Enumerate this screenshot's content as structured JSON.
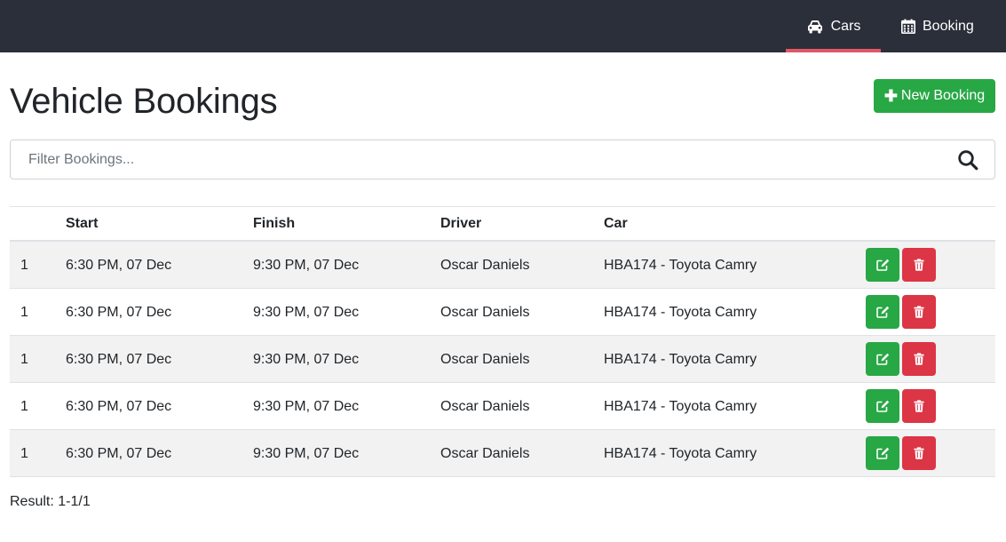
{
  "nav": {
    "items": [
      {
        "label": "Cars",
        "icon": "car-icon",
        "active": true
      },
      {
        "label": "Booking",
        "icon": "calendar-icon",
        "active": false
      }
    ]
  },
  "page": {
    "title": "Vehicle Bookings"
  },
  "actions": {
    "new_booking_label": "New Booking"
  },
  "search": {
    "placeholder": "Filter Bookings..."
  },
  "table": {
    "headers": [
      "",
      "Start",
      "Finish",
      "Driver",
      "Car",
      ""
    ],
    "rows": [
      {
        "id": "1",
        "start": "6:30 PM, 07 Dec",
        "finish": "9:30 PM, 07 Dec",
        "driver": "Oscar Daniels",
        "car": "HBA174 - Toyota Camry"
      },
      {
        "id": "1",
        "start": "6:30 PM, 07 Dec",
        "finish": "9:30 PM, 07 Dec",
        "driver": "Oscar Daniels",
        "car": "HBA174 - Toyota Camry"
      },
      {
        "id": "1",
        "start": "6:30 PM, 07 Dec",
        "finish": "9:30 PM, 07 Dec",
        "driver": "Oscar Daniels",
        "car": "HBA174 - Toyota Camry"
      },
      {
        "id": "1",
        "start": "6:30 PM, 07 Dec",
        "finish": "9:30 PM, 07 Dec",
        "driver": "Oscar Daniels",
        "car": "HBA174 - Toyota Camry"
      },
      {
        "id": "1",
        "start": "6:30 PM, 07 Dec",
        "finish": "9:30 PM, 07 Dec",
        "driver": "Oscar Daniels",
        "car": "HBA174 - Toyota Camry"
      }
    ]
  },
  "footer": {
    "result": "Result: 1-1/1"
  },
  "colors": {
    "navbar": "#2b2f3a",
    "active_underline": "#e05766",
    "success": "#28a745",
    "danger": "#dc3545",
    "row_stripe": "#f2f2f2"
  }
}
